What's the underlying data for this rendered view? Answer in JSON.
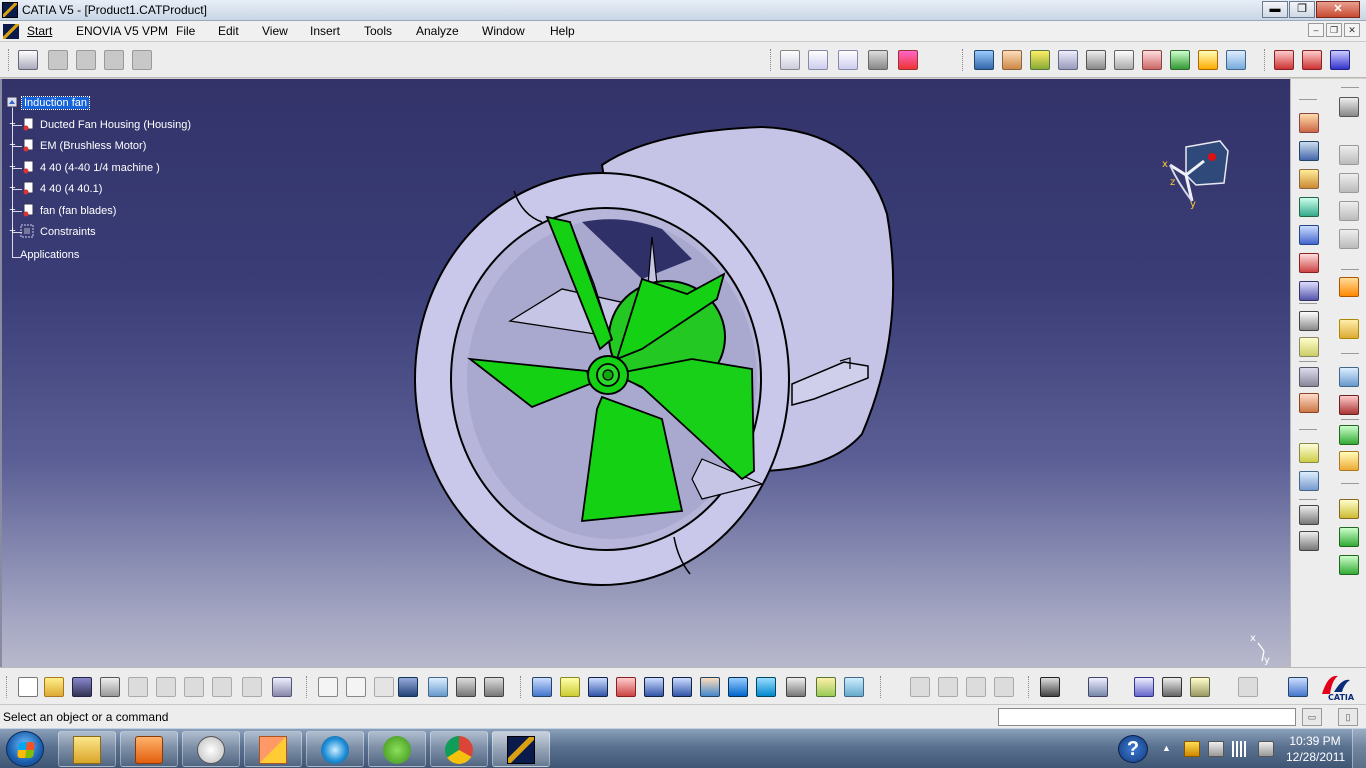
{
  "window": {
    "title": "CATIA V5 - [Product1.CATProduct]",
    "minimize": "▬",
    "restore": "❐",
    "close": "✕"
  },
  "menu": {
    "items": [
      "Start",
      "ENOVIA V5 VPM",
      "File",
      "Edit",
      "View",
      "Insert",
      "Tools",
      "Analyze",
      "Window",
      "Help"
    ]
  },
  "mdi_controls": [
    "–",
    "❐",
    "✕"
  ],
  "tree": {
    "root": "Induction fan",
    "children": [
      "Ducted Fan Housing (Housing)",
      "EM (Brushless Motor)",
      "4 40 (4-40 1/4 machine )",
      "4 40 (4 40.1)",
      "fan (fan blades)",
      "Constraints"
    ],
    "applications": "Applications"
  },
  "compass": {
    "x_label": "x",
    "y_label": "y",
    "z_label": "z"
  },
  "axis_triad": {
    "x_label": "x",
    "y_label": "y"
  },
  "status": {
    "message": "Select an object or a command",
    "command_input": ""
  },
  "taskbar": {
    "time": "10:39 PM",
    "date": "12/28/2011",
    "help": "?"
  },
  "colors": {
    "viewport_top": "#33336a",
    "viewport_bottom": "#b8b9cc",
    "housing": "#c9c9e8",
    "fan": "#1fd11f",
    "tree_selection": "#1463d8"
  }
}
